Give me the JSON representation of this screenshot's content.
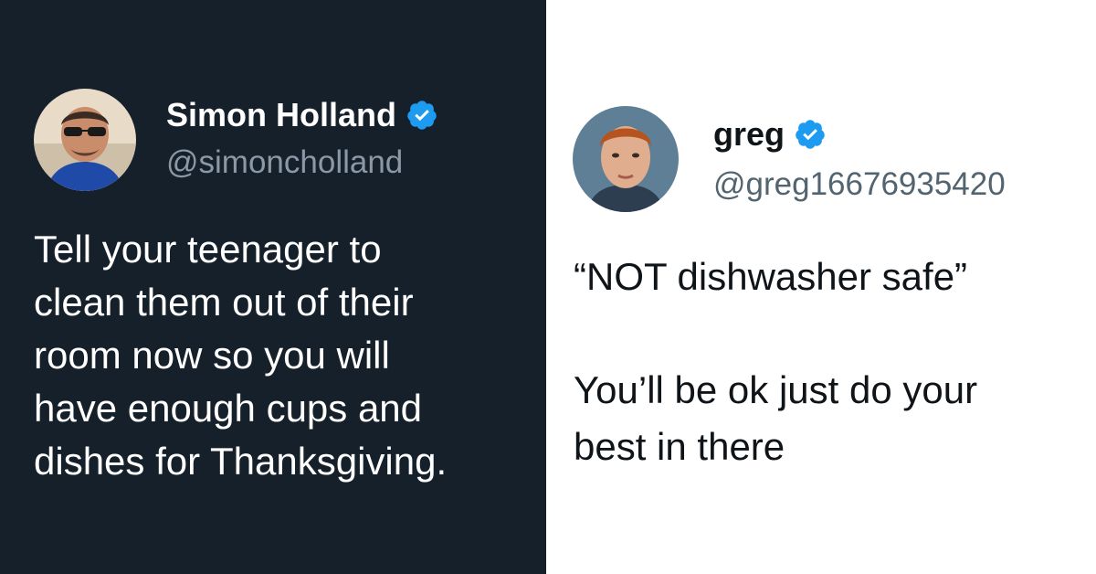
{
  "left_tweet": {
    "display_name": "Simon Holland",
    "handle": "@simoncholland",
    "text": "Tell your teenager to\nclean them out of their\nroom now so you will\nhave enough cups and\ndishes for Thanksgiving.",
    "verified_icon": "verified-badge-icon",
    "background_color": "#15202b",
    "text_color": "#ffffff",
    "handle_color": "#8b98a5"
  },
  "right_tweet": {
    "display_name": "greg",
    "handle": "@greg16676935420",
    "text": "“NOT dishwasher safe”\n\nYou’ll be ok just do your\nbest in there",
    "verified_icon": "verified-badge-icon",
    "background_color": "#ffffff",
    "text_color": "#0f1419",
    "handle_color": "#536471"
  },
  "colors": {
    "verified_blue": "#1d9bf0"
  }
}
